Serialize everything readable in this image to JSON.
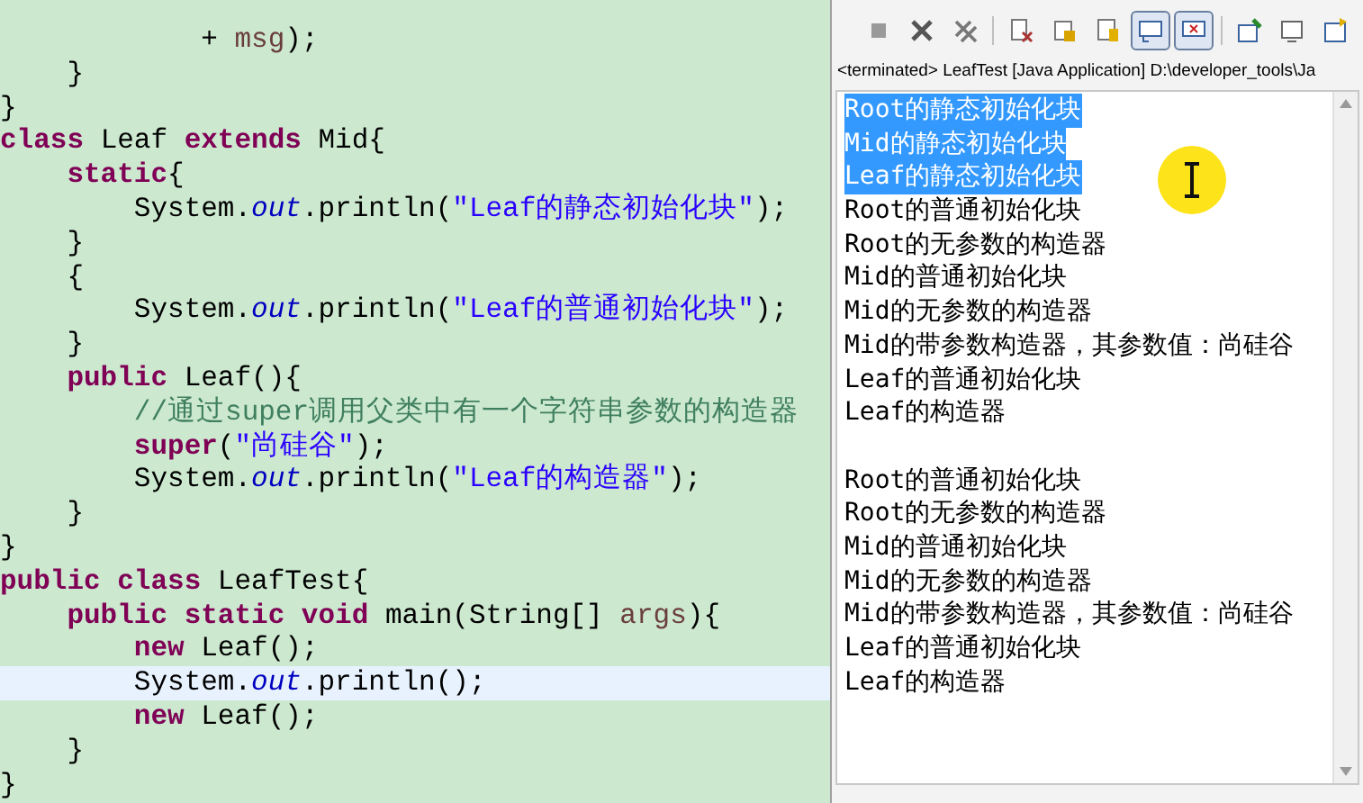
{
  "editor": {
    "lines": [
      {
        "current": false,
        "segments": [
          {
            "kind": "plain",
            "text": "            + "
          },
          {
            "kind": "param",
            "text": "msg"
          },
          {
            "kind": "plain",
            "text": ");"
          }
        ]
      },
      {
        "current": false,
        "segments": [
          {
            "kind": "plain",
            "text": "    }"
          }
        ]
      },
      {
        "current": false,
        "segments": [
          {
            "kind": "plain",
            "text": "}"
          }
        ]
      },
      {
        "current": false,
        "segments": [
          {
            "kind": "keyword",
            "text": "class"
          },
          {
            "kind": "plain",
            "text": " Leaf "
          },
          {
            "kind": "keyword",
            "text": "extends"
          },
          {
            "kind": "plain",
            "text": " Mid{"
          }
        ]
      },
      {
        "current": false,
        "segments": [
          {
            "kind": "keyword",
            "text": "    static"
          },
          {
            "kind": "plain",
            "text": "{"
          }
        ]
      },
      {
        "current": false,
        "segments": [
          {
            "kind": "plain",
            "text": "        System."
          },
          {
            "kind": "field",
            "text": "out"
          },
          {
            "kind": "plain",
            "text": ".println("
          },
          {
            "kind": "string",
            "text": "\"Leaf的静态初始化块\""
          },
          {
            "kind": "plain",
            "text": ");"
          }
        ]
      },
      {
        "current": false,
        "segments": [
          {
            "kind": "plain",
            "text": "    }"
          }
        ]
      },
      {
        "current": false,
        "segments": [
          {
            "kind": "plain",
            "text": "    {"
          }
        ]
      },
      {
        "current": false,
        "segments": [
          {
            "kind": "plain",
            "text": "        System."
          },
          {
            "kind": "field",
            "text": "out"
          },
          {
            "kind": "plain",
            "text": ".println("
          },
          {
            "kind": "string",
            "text": "\"Leaf的普通初始化块\""
          },
          {
            "kind": "plain",
            "text": ");"
          }
        ]
      },
      {
        "current": false,
        "segments": [
          {
            "kind": "plain",
            "text": "    }"
          }
        ]
      },
      {
        "current": false,
        "segments": [
          {
            "kind": "keyword",
            "text": "    public"
          },
          {
            "kind": "plain",
            "text": " Leaf(){"
          }
        ]
      },
      {
        "current": false,
        "segments": [
          {
            "kind": "comment",
            "text": "        //通过super调用父类中有一个字符串参数的构造器"
          }
        ]
      },
      {
        "current": false,
        "segments": [
          {
            "kind": "keyword",
            "text": "        super"
          },
          {
            "kind": "plain",
            "text": "("
          },
          {
            "kind": "string",
            "text": "\"尚硅谷\""
          },
          {
            "kind": "plain",
            "text": ");"
          }
        ]
      },
      {
        "current": false,
        "segments": [
          {
            "kind": "plain",
            "text": "        System."
          },
          {
            "kind": "field",
            "text": "out"
          },
          {
            "kind": "plain",
            "text": ".println("
          },
          {
            "kind": "string",
            "text": "\"Leaf的构造器\""
          },
          {
            "kind": "plain",
            "text": ");"
          }
        ]
      },
      {
        "current": false,
        "segments": [
          {
            "kind": "plain",
            "text": "    }"
          }
        ]
      },
      {
        "current": false,
        "segments": [
          {
            "kind": "plain",
            "text": "}"
          }
        ]
      },
      {
        "current": false,
        "segments": [
          {
            "kind": "keyword",
            "text": "public class"
          },
          {
            "kind": "plain",
            "text": " LeafTest{"
          }
        ]
      },
      {
        "current": false,
        "segments": [
          {
            "kind": "keyword",
            "text": "    public static void"
          },
          {
            "kind": "plain",
            "text": " main(String[] "
          },
          {
            "kind": "param",
            "text": "args"
          },
          {
            "kind": "plain",
            "text": "){"
          }
        ]
      },
      {
        "current": false,
        "segments": [
          {
            "kind": "keyword",
            "text": "        new"
          },
          {
            "kind": "plain",
            "text": " Leaf();"
          }
        ]
      },
      {
        "current": true,
        "segments": [
          {
            "kind": "plain",
            "text": "        System."
          },
          {
            "kind": "field",
            "text": "out"
          },
          {
            "kind": "plain",
            "text": ".println();"
          }
        ]
      },
      {
        "current": false,
        "segments": [
          {
            "kind": "keyword",
            "text": "        new"
          },
          {
            "kind": "plain",
            "text": " Leaf();"
          }
        ]
      },
      {
        "current": false,
        "segments": [
          {
            "kind": "plain",
            "text": "    }"
          }
        ]
      },
      {
        "current": false,
        "segments": [
          {
            "kind": "plain",
            "text": "}"
          }
        ]
      }
    ]
  },
  "console": {
    "toolbar": [
      {
        "kind": "stop",
        "pressed": false
      },
      {
        "kind": "remove",
        "pressed": false
      },
      {
        "kind": "remove_all",
        "pressed": false
      },
      {
        "kind": "clear",
        "pressed": false
      },
      {
        "kind": "scroll_lock",
        "pressed": false
      },
      {
        "kind": "word_wrap",
        "pressed": false
      },
      {
        "kind": "show_stdout",
        "pressed": true
      },
      {
        "kind": "show_stderr",
        "pressed": true
      },
      {
        "kind": "pin",
        "pressed": false
      },
      {
        "kind": "display",
        "pressed": false
      },
      {
        "kind": "open_console",
        "pressed": false
      }
    ],
    "header": "<terminated> LeafTest [Java Application] D:\\developer_tools\\Ja",
    "blocks": [
      {
        "lines": [
          {
            "text": "Root的静态初始化块",
            "selected": true
          },
          {
            "text": "Mid的静态初始化块",
            "selected": true
          },
          {
            "text": "Leaf的静态初始化块",
            "selected": true
          },
          {
            "text": "Root的普通初始化块",
            "selected": false
          },
          {
            "text": "Root的无参数的构造器",
            "selected": false
          },
          {
            "text": "Mid的普通初始化块",
            "selected": false
          },
          {
            "text": "Mid的无参数的构造器",
            "selected": false
          },
          {
            "text": "Mid的带参数构造器，其参数值：尚硅谷",
            "selected": false
          },
          {
            "text": "Leaf的普通初始化块",
            "selected": false
          },
          {
            "text": "Leaf的构造器",
            "selected": false
          }
        ]
      },
      {
        "lines": [
          {
            "text": "Root的普通初始化块",
            "selected": false
          },
          {
            "text": "Root的无参数的构造器",
            "selected": false
          },
          {
            "text": "Mid的普通初始化块",
            "selected": false
          },
          {
            "text": "Mid的无参数的构造器",
            "selected": false
          },
          {
            "text": "Mid的带参数构造器，其参数值：尚硅谷",
            "selected": false
          },
          {
            "text": "Leaf的普通初始化块",
            "selected": false
          },
          {
            "text": "Leaf的构造器",
            "selected": false
          }
        ]
      }
    ]
  }
}
